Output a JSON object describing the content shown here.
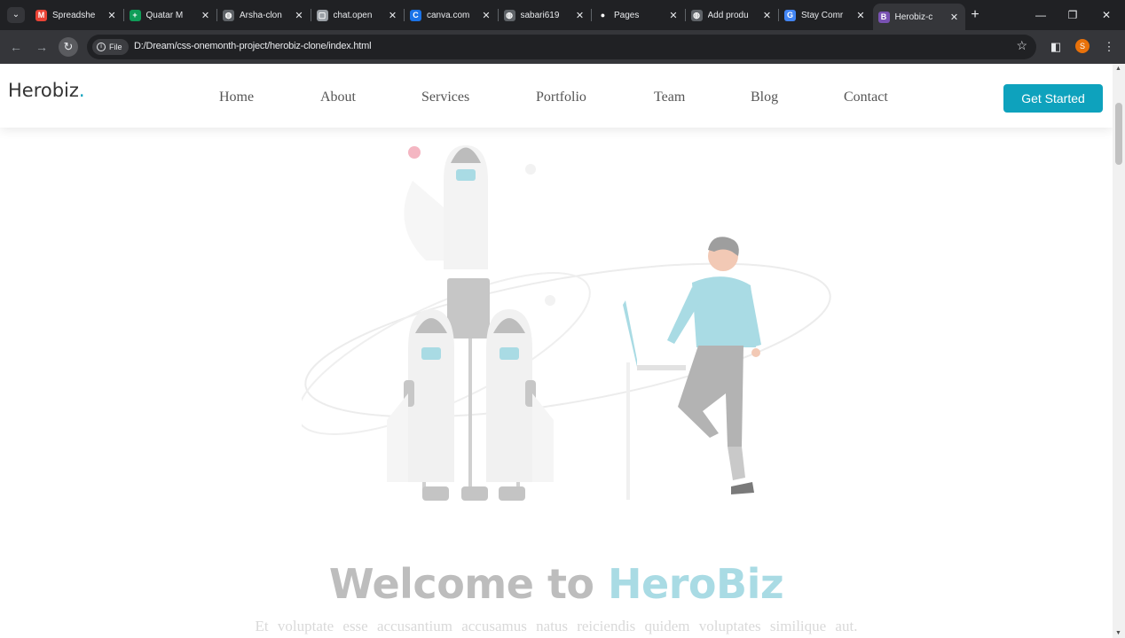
{
  "browser": {
    "tabs": [
      {
        "title": "Spreadshe",
        "favicon": "gmail-icon",
        "color": "#ea4335",
        "glyph": "M"
      },
      {
        "title": "Quatar M",
        "favicon": "sheets-icon",
        "color": "#0f9d58",
        "glyph": "+"
      },
      {
        "title": "Arsha-clon",
        "favicon": "globe-icon",
        "color": "#5f6368",
        "glyph": "◍"
      },
      {
        "title": "chat.open",
        "favicon": "page-icon",
        "color": "#9aa0a6",
        "glyph": "▢"
      },
      {
        "title": "canva.com",
        "favicon": "canva-icon",
        "color": "#1a73e8",
        "glyph": "C"
      },
      {
        "title": "sabari619",
        "favicon": "globe-icon",
        "color": "#5f6368",
        "glyph": "◍"
      },
      {
        "title": "Pages",
        "favicon": "github-icon",
        "color": "#202124",
        "glyph": "●"
      },
      {
        "title": "Add produ",
        "favicon": "globe-icon",
        "color": "#5f6368",
        "glyph": "◍"
      },
      {
        "title": "Stay Comr",
        "favicon": "google-icon",
        "color": "#4285f4",
        "glyph": "G"
      },
      {
        "title": "Herobiz-c",
        "favicon": "bootstrap-icon",
        "color": "#7952b3",
        "glyph": "B",
        "active": true
      }
    ],
    "address": {
      "chip_label": "File",
      "url": "D:/Dream/css-onemonth-project/herobiz-clone/index.html"
    },
    "profile_initial": "S"
  },
  "site": {
    "logo": {
      "text": "Herobiz",
      "dot": "."
    },
    "nav": [
      "Home",
      "About",
      "Services",
      "Portfolio",
      "Team",
      "Blog",
      "Contact"
    ],
    "cta": "Get Started",
    "accent": "#0ea2bd",
    "hero": {
      "title_prefix": "Welcome to ",
      "title_brand": "HeroBiz",
      "subtitle": "Et voluptate esse accusantium accusamus natus reiciendis quidem voluptates similique aut."
    }
  }
}
